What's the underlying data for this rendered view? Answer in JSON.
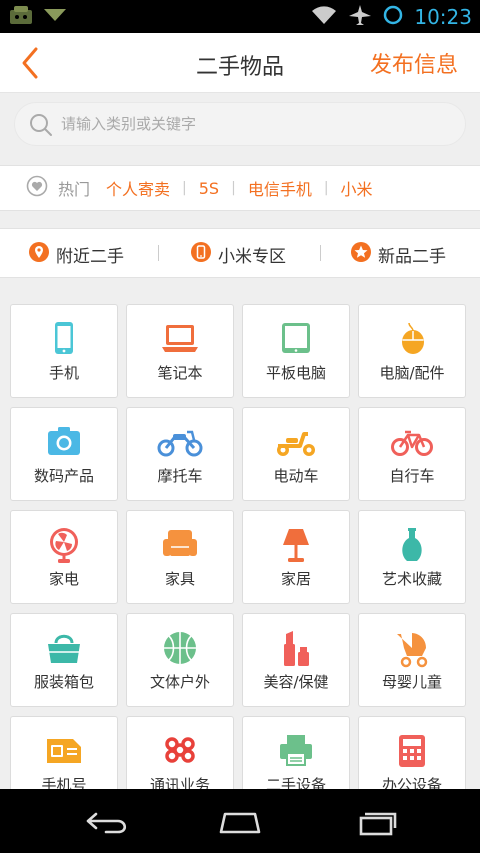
{
  "status_bar": {
    "time": "10:23",
    "left_icons": [
      "android-icon",
      "download-icon"
    ],
    "right_icons": [
      "wifi-icon",
      "airplane-icon",
      "sync-icon"
    ]
  },
  "header": {
    "title": "二手物品",
    "publish_label": "发布信息",
    "accent_color": "#f37021"
  },
  "search": {
    "placeholder": "请输入类别或关键字",
    "value": ""
  },
  "hot": {
    "label": "热门",
    "tags": [
      "个人寄卖",
      "5S",
      "电信手机",
      "小米"
    ]
  },
  "quick_links": [
    {
      "label": "附近二手",
      "icon": "location-icon"
    },
    {
      "label": "小米专区",
      "icon": "phone-icon"
    },
    {
      "label": "新品二手",
      "icon": "star-icon"
    }
  ],
  "categories": [
    {
      "label": "手机",
      "icon": "mobile-icon"
    },
    {
      "label": "笔记本",
      "icon": "laptop-icon"
    },
    {
      "label": "平板电脑",
      "icon": "tablet-icon"
    },
    {
      "label": "电脑/配件",
      "icon": "mouse-icon"
    },
    {
      "label": "数码产品",
      "icon": "camera-icon"
    },
    {
      "label": "摩托车",
      "icon": "motorcycle-icon"
    },
    {
      "label": "电动车",
      "icon": "scooter-icon"
    },
    {
      "label": "自行车",
      "icon": "bicycle-icon"
    },
    {
      "label": "家电",
      "icon": "fan-icon"
    },
    {
      "label": "家具",
      "icon": "sofa-icon"
    },
    {
      "label": "家居",
      "icon": "lamp-icon"
    },
    {
      "label": "艺术收藏",
      "icon": "vase-icon"
    },
    {
      "label": "服装箱包",
      "icon": "bag-icon"
    },
    {
      "label": "文体户外",
      "icon": "basketball-icon"
    },
    {
      "label": "美容/保健",
      "icon": "lipstick-icon"
    },
    {
      "label": "母婴儿童",
      "icon": "stroller-icon"
    },
    {
      "label": "手机号",
      "icon": "sim-card-icon"
    },
    {
      "label": "通讯业务",
      "icon": "unicom-icon"
    },
    {
      "label": "二手设备",
      "icon": "printer-icon"
    },
    {
      "label": "办公设备",
      "icon": "calculator-icon"
    }
  ],
  "nav_bar": [
    "back-icon",
    "home-icon",
    "recents-icon"
  ]
}
